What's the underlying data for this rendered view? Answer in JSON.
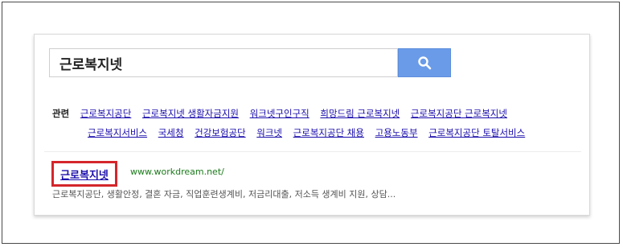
{
  "search": {
    "query": "근로복지넷"
  },
  "related": {
    "label": "관련",
    "items": [
      "근로복지공단",
      "근로복지넷 생활자금지원",
      "워크넷구인구직",
      "희망드림 근로복지넷",
      "근로복지공단 근로복지넷",
      "근로복지서비스",
      "국세청",
      "건강보험공단",
      "워크넷",
      "근로복지공단 채용",
      "고용노동부",
      "근로복지공단 토탈서비스"
    ]
  },
  "result": {
    "title": "근로복지넷",
    "url": "www.workdream.net/",
    "snippet": "근로복지공단, 생활안정, 결혼 자금, 직업훈련생계비, 저금리대출, 저소득 생계비 지원, 상담..."
  },
  "colors": {
    "highlight": "#d4262b",
    "search_button": "#6a9be8",
    "link": "#1a0dab",
    "url": "#1a7a1a"
  },
  "icons": {
    "search_button": "magnifier-icon"
  }
}
